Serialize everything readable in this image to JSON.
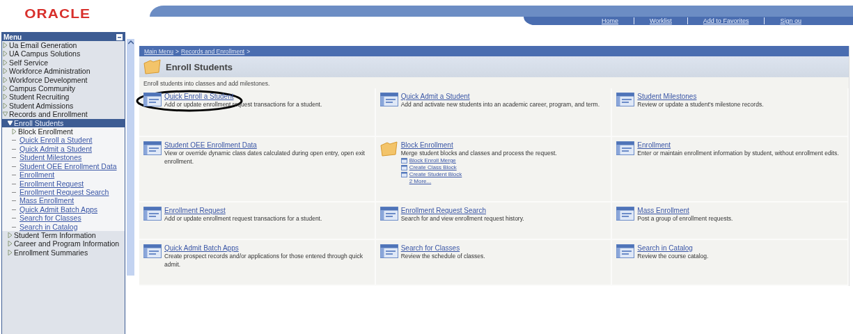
{
  "logo": "ORACLE",
  "top_nav": [
    "Home",
    "Worklist",
    "Add to Favorites",
    "Sign ou"
  ],
  "menu": {
    "title": "Menu",
    "items": [
      {
        "label": "Ua Email Generation",
        "kind": "folder",
        "expanded": false,
        "selected": false
      },
      {
        "label": "UA Campus Solutions",
        "kind": "folder",
        "expanded": false,
        "selected": false
      },
      {
        "label": "Self Service",
        "kind": "folder",
        "expanded": false,
        "selected": false
      },
      {
        "label": "Workforce Administration",
        "kind": "folder",
        "expanded": false,
        "selected": false
      },
      {
        "label": "Workforce Development",
        "kind": "folder",
        "expanded": false,
        "selected": false
      },
      {
        "label": "Campus Community",
        "kind": "folder",
        "expanded": false,
        "selected": false
      },
      {
        "label": "Student Recruiting",
        "kind": "folder",
        "expanded": false,
        "selected": false
      },
      {
        "label": "Student Admissions",
        "kind": "folder",
        "expanded": false,
        "selected": false
      },
      {
        "label": "Records and Enrollment",
        "kind": "folder",
        "expanded": true,
        "selected": false,
        "children": [
          {
            "label": "Enroll Students",
            "kind": "folder",
            "expanded": true,
            "selected": true,
            "children": [
              {
                "label": "Block Enrollment",
                "kind": "folder",
                "expanded": false,
                "selected": false
              },
              {
                "label": "Quick Enroll a Student",
                "kind": "link",
                "selected": false
              },
              {
                "label": "Quick Admit a Student",
                "kind": "link",
                "selected": false
              },
              {
                "label": "Student Milestones",
                "kind": "link",
                "selected": false
              },
              {
                "label": "Student OEE Enrollment Data",
                "kind": "link",
                "selected": false
              },
              {
                "label": "Enrollment",
                "kind": "link",
                "selected": false
              },
              {
                "label": "Enrollment Request",
                "kind": "link",
                "selected": false
              },
              {
                "label": "Enrollment Request Search",
                "kind": "link",
                "selected": false
              },
              {
                "label": "Mass Enrollment",
                "kind": "link",
                "selected": false
              },
              {
                "label": "Quick Admit Batch Apps",
                "kind": "link",
                "selected": false
              },
              {
                "label": "Search for Classes",
                "kind": "link",
                "selected": false
              },
              {
                "label": "Search in Catalog",
                "kind": "link",
                "selected": false
              }
            ]
          },
          {
            "label": "Student Term Information",
            "kind": "folder",
            "expanded": false,
            "selected": false
          },
          {
            "label": "Career and Program Information",
            "kind": "folder",
            "expanded": false,
            "selected": false
          },
          {
            "label": "Enrollment Summaries",
            "kind": "folder",
            "expanded": false,
            "selected": false
          }
        ]
      }
    ]
  },
  "breadcrumb": [
    {
      "label": "Main Menu",
      "separator": ">"
    },
    {
      "label": "Records and Enrollment",
      "separator": ">"
    }
  ],
  "page": {
    "title": "Enroll Students",
    "description": "Enroll students into classes and add milestones."
  },
  "tiles": [
    {
      "kind": "component",
      "title": "Quick Enroll a Student",
      "description": "Add or update enrollment request transactions for a student."
    },
    {
      "kind": "component",
      "title": "Quick Admit a Student",
      "description": "Add and activate new students into an academic career, program, and term."
    },
    {
      "kind": "component",
      "title": "Student Milestones",
      "description": "Review or update a student's milestone records."
    },
    {
      "kind": "component",
      "title": "Student OEE Enrollment Data",
      "description": "View or override dynamic class dates calculated during open entry, open exit enrollment."
    },
    {
      "kind": "folder",
      "title": "Block Enrollment",
      "description": "Merge student blocks and classes and process the request.",
      "links": [
        "Block Enroll Merge",
        "Create Class Block",
        "Create Student Block"
      ],
      "more": "2 More..."
    },
    {
      "kind": "component",
      "title": "Enrollment",
      "description": "Enter or maintain enrollment information by student, without enrollment edits."
    },
    {
      "kind": "component",
      "title": "Enrollment Request",
      "description": "Add or update enrollment request transactions for a student."
    },
    {
      "kind": "component",
      "title": "Enrollment Request Search",
      "description": "Search for and view enrollment request history."
    },
    {
      "kind": "component",
      "title": "Mass Enrollment",
      "description": "Post a group of enrollment requests."
    },
    {
      "kind": "component",
      "title": "Quick Admit Batch Apps",
      "description": "Create prospect records and/or applications for those entered through quick admit."
    },
    {
      "kind": "component",
      "title": "Search for Classes",
      "description": "Review the schedule of classes."
    },
    {
      "kind": "component",
      "title": "Search in Catalog",
      "description": "Review the course catalog."
    }
  ]
}
